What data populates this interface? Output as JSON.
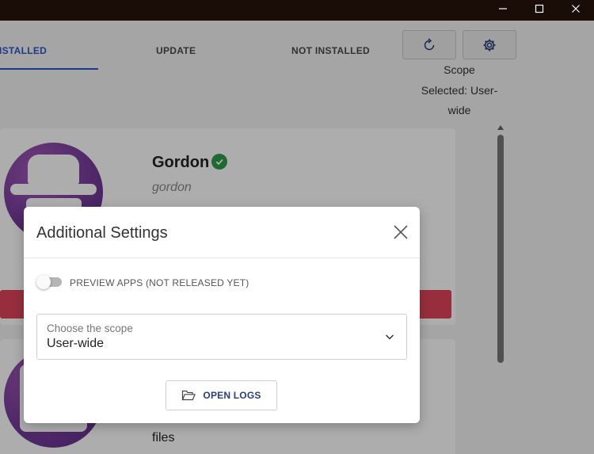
{
  "window": {
    "minimize_icon": "minimize-icon",
    "maximize_icon": "maximize-icon",
    "close_icon": "close-icon"
  },
  "tabs": [
    {
      "label": "INSTALLED",
      "active": true
    },
    {
      "label": "UPDATE",
      "active": false
    },
    {
      "label": "NOT INSTALLED",
      "active": false
    }
  ],
  "toolbar": {
    "refresh_icon": "refresh-icon",
    "settings_icon": "gear-icon"
  },
  "scope_info": {
    "title": "Scope",
    "selected_text": "Selected: User-wide"
  },
  "packages": [
    {
      "title": "Gordon",
      "id": "gordon",
      "verified": true
    },
    {
      "snippet": "files"
    }
  ],
  "dialog": {
    "title": "Additional Settings",
    "close_icon": "close-icon",
    "preview_toggle": {
      "label": "PREVIEW APPS (NOT RELEASED YET)",
      "enabled": false
    },
    "scope_select": {
      "label": "Choose the scope",
      "value": "User-wide"
    },
    "open_logs": {
      "label": "OPEN LOGS",
      "icon": "folder-open-icon"
    }
  },
  "colors": {
    "accent": "#2f56c4",
    "danger": "#e0455a",
    "verified": "#2e9b4c",
    "avatar": "#7b3f9e"
  }
}
